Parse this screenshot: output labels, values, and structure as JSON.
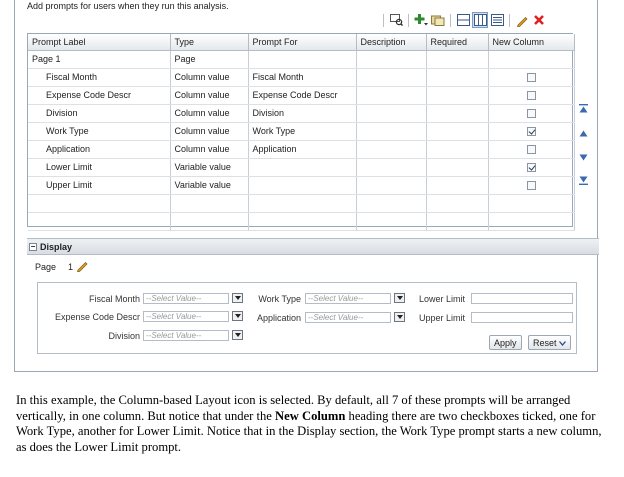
{
  "intro_text": "Add prompts for users when they run this analysis.",
  "toolbar": {
    "icons": [
      "preview-icon",
      "add-prompt-icon",
      "add-from-catalog-icon",
      "row-layout-icon",
      "column-layout-icon",
      "list-layout-icon",
      "edit-icon",
      "delete-icon"
    ]
  },
  "table": {
    "headers": [
      "Prompt Label",
      "Type",
      "Prompt For",
      "Description",
      "Required",
      "New Column"
    ],
    "rows": [
      {
        "label": "Page 1",
        "type": "Page",
        "for": "",
        "new_column": null
      },
      {
        "label": "Fiscal Month",
        "type": "Column value",
        "for": "Fiscal Month",
        "new_column": false
      },
      {
        "label": "Expense Code Descr",
        "type": "Column value",
        "for": "Expense Code Descr",
        "new_column": false
      },
      {
        "label": "Division",
        "type": "Column value",
        "for": "Division",
        "new_column": false
      },
      {
        "label": "Work Type",
        "type": "Column value",
        "for": "Work Type",
        "new_column": true
      },
      {
        "label": "Application",
        "type": "Column value",
        "for": "Application",
        "new_column": false
      },
      {
        "label": "Lower Limit",
        "type": "Variable value",
        "for": "",
        "new_column": true
      },
      {
        "label": "Upper Limit",
        "type": "Variable value",
        "for": "",
        "new_column": false
      }
    ]
  },
  "display": {
    "title": "Display",
    "page_label": "Page",
    "page_value": "1",
    "prompts": {
      "fiscal_month": "Fiscal Month",
      "expense_code": "Expense Code Descr",
      "division": "Division",
      "work_type": "Work Type",
      "application": "Application",
      "lower_limit": "Lower Limit",
      "upper_limit": "Upper Limit",
      "select_placeholder": "--Select Value--"
    },
    "apply_label": "Apply",
    "reset_label": "Reset"
  },
  "description": {
    "part1": "In this example, the Column-based Layout icon is selected.  By default, all 7 of these prompts will be arranged vertically, in one column.  But notice that under the ",
    "bold": "New Column",
    "part2": " heading there are two checkboxes ticked, one for Work Type, another for Lower Limit.  Notice that in the Display section, the Work Type prompt starts a new column, as does the Lower Limit prompt."
  }
}
